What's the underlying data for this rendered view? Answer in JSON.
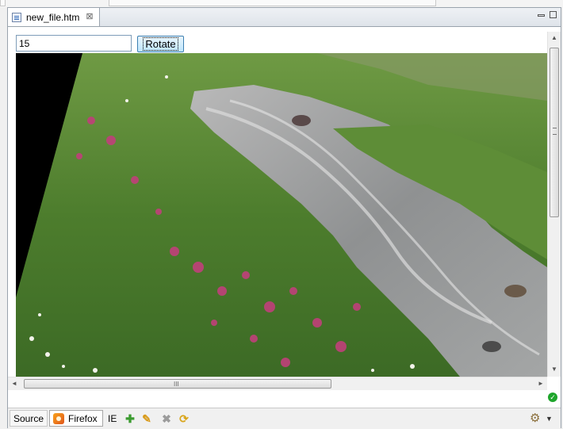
{
  "editor": {
    "tab_title": "new_file.htm",
    "tab_icon": "html-file-icon",
    "close_glyph": "⊠"
  },
  "page": {
    "degrees_value": "15",
    "rotate_label": "Rotate"
  },
  "scrollbars": {
    "up": "▲",
    "down": "▼",
    "left": "◄",
    "right": "►",
    "h_grip": "III"
  },
  "bottom": {
    "tabs": [
      "Source",
      "Firefox",
      "IE"
    ],
    "active_tab": "Firefox",
    "tools": [
      "add-icon",
      "edit-icon",
      "delete-icon",
      "refresh-icon"
    ]
  },
  "colors": {
    "status_ok": "#1ea52b",
    "button_border": "#3c7fb1"
  }
}
